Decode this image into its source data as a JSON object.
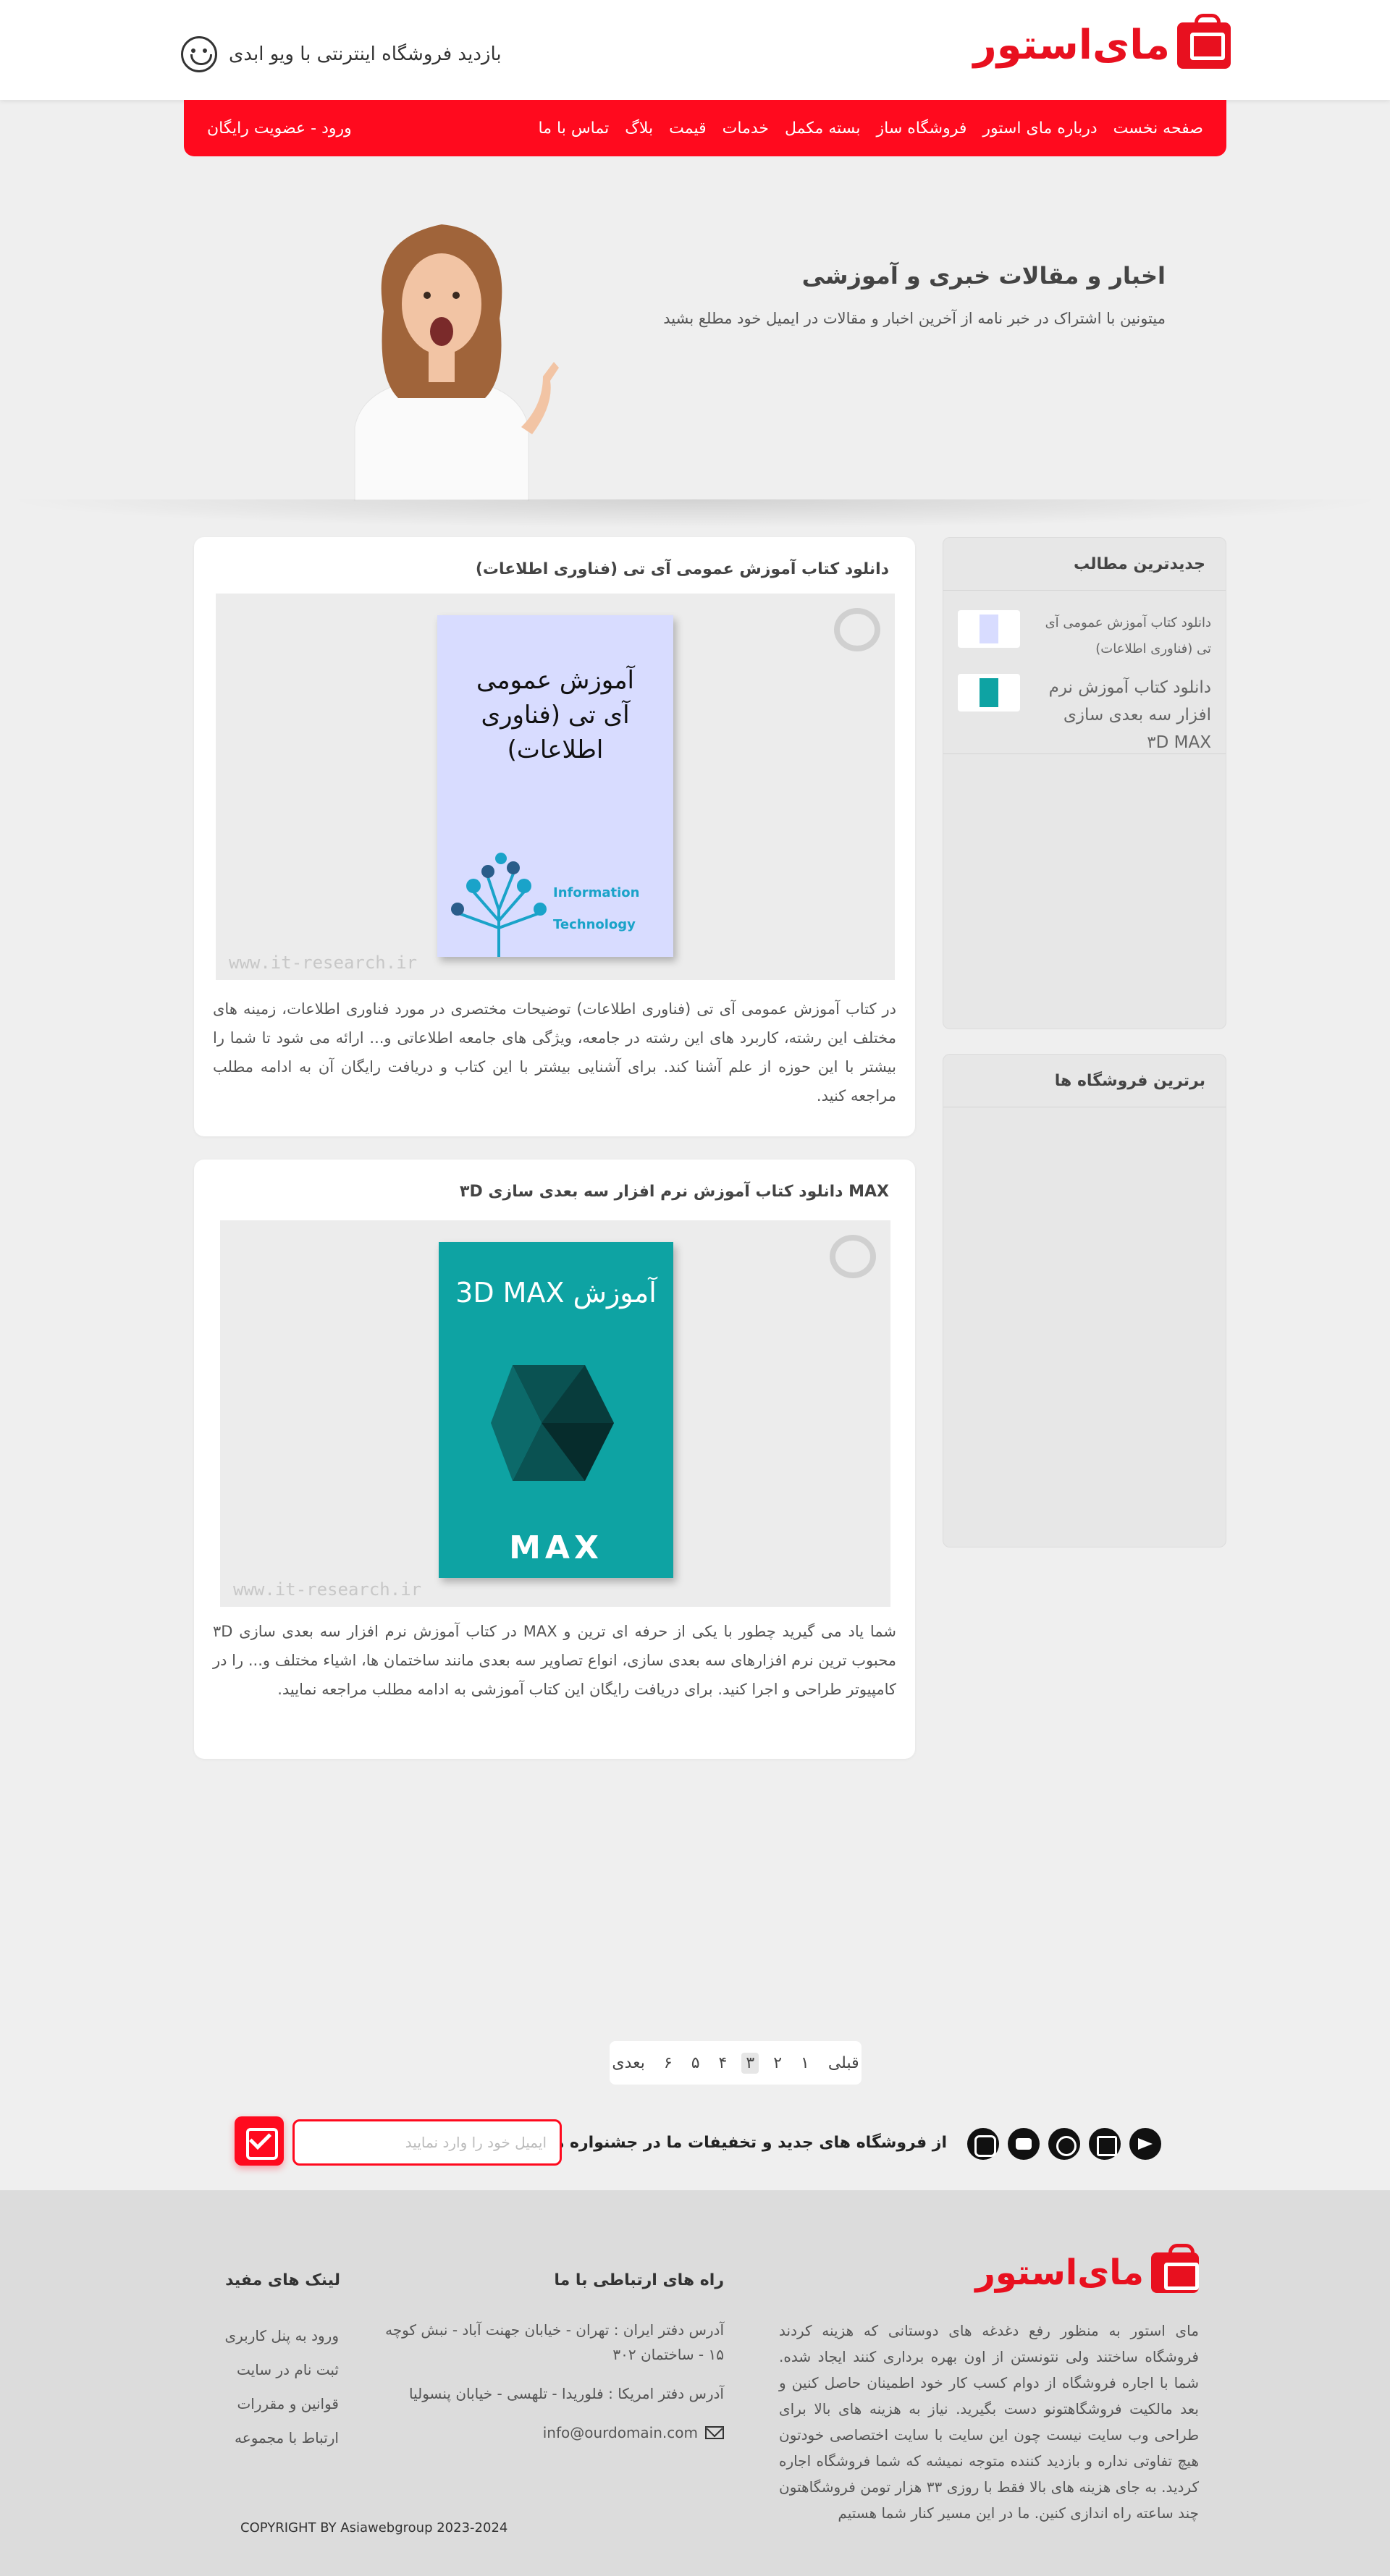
{
  "header": {
    "logo_text": "مای‌استور",
    "visit_text": "بازدید فروشگاه اینترنتی با ویو ابدی"
  },
  "nav": {
    "items": [
      "صفحه نخست",
      "درباره مای استور",
      "فروشگاه ساز",
      "بسته مکمل",
      "خدمات",
      "قیمت",
      "بلاگ",
      "تماس با ما"
    ],
    "login": "ورود - عضویت رایگان"
  },
  "hero": {
    "title": "اخبار و مقالات خبری و آموزشی",
    "subtitle": "میتونین با اشتراک در خبر نامه از آخرین اخبار و مقالات در ایمیل خود مطلع بشید"
  },
  "posts": [
    {
      "title": "دانلود کتاب آموزش عمومی آی تی (فناوری اطلاعات)",
      "book_title": "آموزش عمومی\nآی تی (فناوری اطلاعات)",
      "watermark": "www.it-research.ir",
      "book_sub1": "Information",
      "book_sub2": "Technology",
      "text": "در کتاب آموزش عمومی آی تی (فناوری اطلاعات) توضیحات مختصری در مورد فناوری اطلاعات، زمینه های مختلف این رشته، کاربرد های این رشته در جامعه، ویژگی های جامعه اطلاعاتی و... ارائه می شود تا شما را بیشتر با این حوزه از علم آشنا کند. برای آشنایی بیشتر با این کتاب و دریافت رایگان آن به ادامه مطلب مراجعه کنید."
    },
    {
      "title": "MAX دانلود کتاب آموزش نرم افزار سه بعدی سازی ۳D",
      "book_title": "آموزش 3D MAX",
      "book_max": "MAX",
      "watermark": "www.it-research.ir",
      "text": "شما یاد می گیرید چطور با یکی از حرفه ای ترین و MAX در کتاب آموزش نرم افزار سه بعدی سازی ۳D محبوب ترین نرم افزارهای سه بعدی سازی، انواع تصاویر سه بعدی مانند ساختمان ها، اشیاء مختلف و... را در کامپیوتر طراحی و اجرا کنید. برای دریافت رایگان این کتاب آموزشی به ادامه مطلب مراجعه نمایید."
    }
  ],
  "sidebar": {
    "recent_title": "جدیدترین مطالب",
    "recent": [
      {
        "text": "دانلود کتاب آموزش عمومی آی تی (فناوری اطلاعات)",
        "color": "#d8dcff"
      },
      {
        "text": "دانلود کتاب آموزش نرم افزار سه بعدی سازی ۳D MAX",
        "color": "#0ea3a3"
      }
    ],
    "stores_title": "برترین فروشگاه ها"
  },
  "pagination": {
    "prev": "قبلی",
    "pages": [
      "۱",
      "۲",
      "۳",
      "۴",
      "۵",
      "۶"
    ],
    "active_index": 2,
    "next": "بعدی"
  },
  "newsletter": {
    "text": "از فروشگاه های جدید و تخفیفات ما در جشنواره ها مطلع شوید",
    "placeholder": "ایمیل خود را وارد نمایید",
    "socials": [
      "telegram-icon",
      "linkedin-icon",
      "whatsapp-icon",
      "youtube-icon",
      "instagram-icon"
    ]
  },
  "footer": {
    "logo_text": "مای‌استور",
    "about": "مای استور به منظور رفع دغدغه های دوستانی که هزینه کردند فروشگاه ساختند ولی نتونستن از اون بهره برداری کنند ایجاد شده. شما با اجاره فروشگاه از دوام کسب کار خود اطمینان حاصل کنین و بعد مالکیت فروشگاهتونو دست بگیرید. نیاز به هزینه های بالا برای طراحی وب سایت نیست چون این سایت با سایت اختصاصی خودتون هیچ تفاوتی نداره و بازدید کننده متوجه نمیشه که شما فروشگاه اجاره کردید. به جای هزینه های بالا فقط با روزی ۳۳ هزار تومن فروشگاهتون چند ساعته راه اندازی کنین. ما در این مسیر کنار شما هستیم",
    "contact_title": "راه های ارتباطی با ما",
    "address_iran": "آدرس دفتر ایران : تهران - خیابان جهنت آباد - نبش کوچه ۱۵ - ساختمان ۳۰۲",
    "address_usa": "آدرس دفتر امریکا : فلوریدا - تلهسی - خیابان پنسولیا",
    "email": "info@ourdomain.com",
    "links_title": "لینک های مفید",
    "links": [
      "ورود به پنل کاربری",
      "ثبت نام در سایت",
      "قوانین و مقررات",
      "ارتباط با مجموعه"
    ],
    "copyright": "COPYRIGHT BY Asiawebgroup  2023-2024"
  },
  "colors": {
    "brand_red": "#ff0a1e",
    "background": "#efefef",
    "footer_bg": "#dcdcdc"
  }
}
